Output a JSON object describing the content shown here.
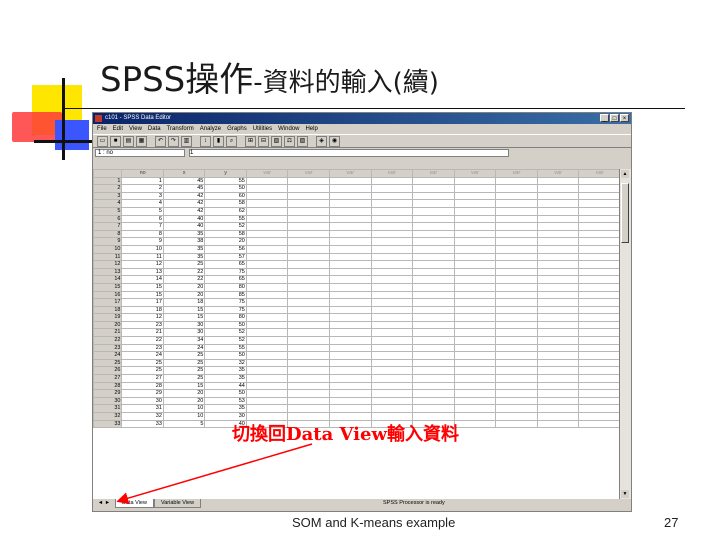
{
  "slide": {
    "title_main": "SPSS操作",
    "title_sub": "-資料的輸入(續)",
    "callout": "切換回Data View輸入資料",
    "footer": "SOM and K-means example",
    "page_number": "27"
  },
  "window": {
    "title": "c101 - SPSS Data Editor",
    "controls": [
      "_",
      "□",
      "×"
    ],
    "menu": [
      "File",
      "Edit",
      "View",
      "Data",
      "Transform",
      "Analyze",
      "Graphs",
      "Utilities",
      "Window",
      "Help"
    ],
    "cell_ref": "1 : no",
    "cell_value": "1"
  },
  "grid": {
    "columns": [
      "no",
      "x",
      "y",
      "var",
      "var",
      "var",
      "var",
      "var",
      "var",
      "var",
      "var",
      "var"
    ],
    "rows": [
      [
        "1",
        "1",
        "45",
        "55"
      ],
      [
        "2",
        "2",
        "45",
        "50"
      ],
      [
        "3",
        "3",
        "42",
        "60"
      ],
      [
        "4",
        "4",
        "42",
        "58"
      ],
      [
        "5",
        "5",
        "42",
        "62"
      ],
      [
        "6",
        "6",
        "40",
        "55"
      ],
      [
        "7",
        "7",
        "40",
        "52"
      ],
      [
        "8",
        "8",
        "35",
        "58"
      ],
      [
        "9",
        "9",
        "38",
        "20"
      ],
      [
        "10",
        "10",
        "35",
        "56"
      ],
      [
        "11",
        "11",
        "35",
        "57"
      ],
      [
        "12",
        "12",
        "25",
        "65"
      ],
      [
        "13",
        "13",
        "22",
        "75"
      ],
      [
        "14",
        "14",
        "22",
        "65"
      ],
      [
        "15",
        "15",
        "20",
        "80"
      ],
      [
        "16",
        "15",
        "20",
        "85"
      ],
      [
        "17",
        "17",
        "18",
        "75"
      ],
      [
        "18",
        "18",
        "15",
        "75"
      ],
      [
        "19",
        "12",
        "15",
        "80"
      ],
      [
        "20",
        "23",
        "30",
        "50"
      ],
      [
        "21",
        "21",
        "30",
        "52"
      ],
      [
        "22",
        "22",
        "34",
        "52"
      ],
      [
        "23",
        "23",
        "24",
        "55"
      ],
      [
        "24",
        "24",
        "25",
        "50"
      ],
      [
        "25",
        "25",
        "25",
        "32"
      ],
      [
        "26",
        "25",
        "25",
        "35"
      ],
      [
        "27",
        "27",
        "25",
        "35"
      ],
      [
        "28",
        "28",
        "15",
        "44"
      ],
      [
        "29",
        "29",
        "20",
        "50"
      ],
      [
        "30",
        "30",
        "20",
        "53"
      ],
      [
        "31",
        "31",
        "10",
        "35"
      ],
      [
        "32",
        "32",
        "10",
        "30"
      ],
      [
        "33",
        "33",
        "5",
        "40"
      ]
    ]
  },
  "tabs": {
    "nav": "◄ ► ",
    "data_view": "Data View",
    "variable_view": "Variable View"
  },
  "status": "SPSS Processor is ready"
}
